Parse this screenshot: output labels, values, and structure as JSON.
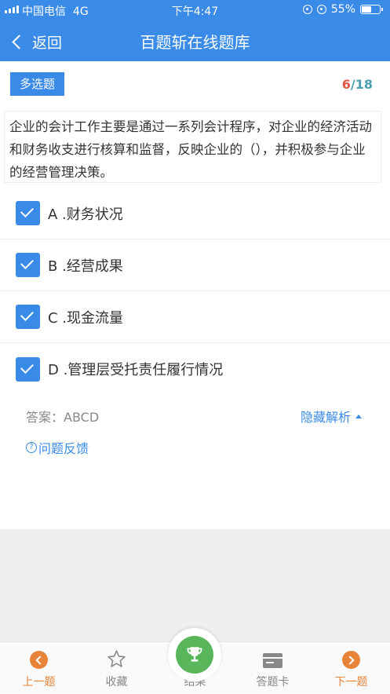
{
  "status_bar": {
    "carrier": "中国电信",
    "network": "4G",
    "time": "下午4:47",
    "battery_percent": "55%",
    "battery_level": 0.55
  },
  "nav": {
    "back_label": "返回",
    "title": "百题斩在线题库"
  },
  "question": {
    "type_label": "多选题",
    "progress_current": "6",
    "progress_sep": "/",
    "progress_total": "18",
    "text": "企业的会计工作主要是通过一系列会计程序，对企业的经济活动和财务收支进行核算和监督，反映企业的（），并积极参与企业的经营管理决策。",
    "options": [
      {
        "label": "A .财务状况",
        "checked": true
      },
      {
        "label": "B .经营成果",
        "checked": true
      },
      {
        "label": "C .现金流量",
        "checked": true
      },
      {
        "label": "D .管理层受托责任履行情况",
        "checked": true
      }
    ]
  },
  "analysis": {
    "answer": "答案：ABCD",
    "hide_label": "隐藏解析",
    "feedback_label": "问题反馈"
  },
  "bottom_bar": {
    "prev": "上一题",
    "favorite": "收藏",
    "result": "结果",
    "answer_card": "答题卡",
    "next": "下一题"
  },
  "colors": {
    "primary": "#3a8be8",
    "accent_orange": "#e8833a",
    "trophy_green": "#5ab65a",
    "progress_current": "#e05a4a",
    "progress_total": "#4a9fb0"
  },
  "icons": {
    "signal": "signal-bars-icon",
    "lock": "rotation-lock-icon",
    "alarm": "alarm-icon",
    "battery": "battery-icon",
    "back": "chevron-left-icon",
    "check": "checkbox-checked-icon",
    "help": "question-circle-icon",
    "prev": "arrow-left-circle-icon",
    "favorite": "star-icon",
    "result": "trophy-icon",
    "answer_card": "card-icon",
    "next": "arrow-right-circle-icon"
  }
}
